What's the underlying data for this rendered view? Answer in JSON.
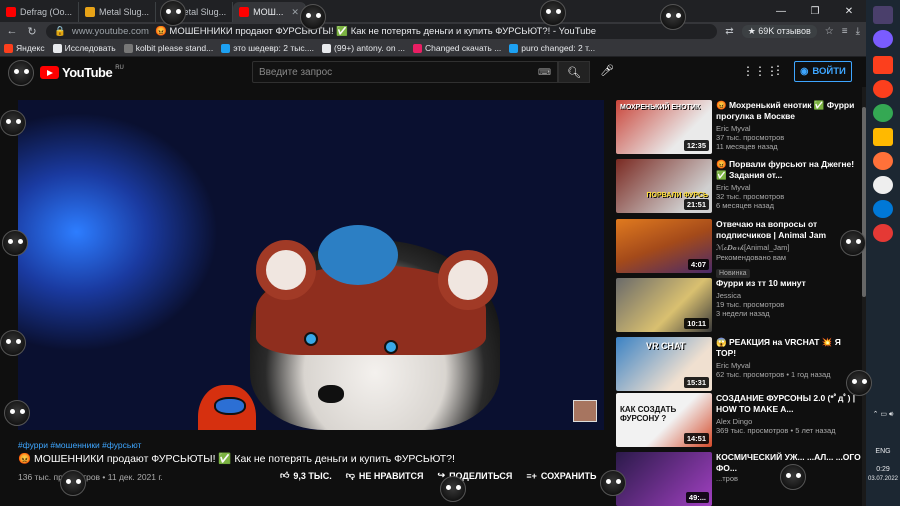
{
  "browser": {
    "tabs": [
      {
        "title": "Defrag (Oo...",
        "fav": "#ff0000",
        "active": false
      },
      {
        "title": "Metal Slug...",
        "fav": "#e8a317",
        "active": false
      },
      {
        "title": "Metal Slug...",
        "fav": "#e8a317",
        "active": false
      },
      {
        "title": "МОШ...",
        "fav": "#ff0000",
        "active": true
      }
    ],
    "window_controls": [
      "—",
      "❐",
      "✕"
    ],
    "address": {
      "url": "www.youtube.com",
      "page_title": "😡 МОШЕННИКИ продают ФУРСЬЮТЫ! ✅ Как не потерять деньги и купить ФУРСЬЮТ?! - YouTube",
      "rating": "★ 69K отзывов"
    },
    "bookmarks": [
      {
        "label": "Яндекс",
        "color": "#fc3f1d"
      },
      {
        "label": "Исследовать",
        "color": "#e8eaed"
      },
      {
        "label": "kolbit please stand...",
        "color": "#777"
      },
      {
        "label": "это шедевр: 2 тыс....",
        "color": "#1da1f2"
      },
      {
        "label": "(99+) antony. on ...",
        "color": "#e8eaed"
      },
      {
        "label": "Changed скачать ...",
        "color": "#e91e63"
      },
      {
        "label": "puro changed: 2 т...",
        "color": "#1da1f2"
      }
    ]
  },
  "youtube": {
    "logo_text": "YouTube",
    "logo_region": "RU",
    "search_placeholder": "Введите запрос",
    "signin_label": "ВОЙТИ",
    "video": {
      "hashtags": "#фурри #мошенники #фурсьют",
      "title": "😡 МОШЕННИКИ продают ФУРСЬЮТЫ! ✅ Как не потерять деньги и купить ФУРСЬЮТ?!",
      "meta": "136 тыс. просмотров • 11 дек. 2021 г.",
      "likes": "9,3 ТЫС.",
      "dislike_label": "НЕ НРАВИТСЯ",
      "share_label": "ПОДЕЛИТЬСЯ",
      "save_label": "СОХРАНИТЬ"
    },
    "related": [
      {
        "title": "😡 Мохренький енотик ✅ Фурри прогулка в Москве",
        "channel": "Eric Myval",
        "stats": "37 тыс. просмотров",
        "age": "11 месяцев назад",
        "duration": "12:35",
        "badge": "",
        "caption": "МОХРЕНЬКИЙ ЕНОТИК",
        "colors": [
          "#c9453a",
          "#eaeaea"
        ]
      },
      {
        "title": "😡 Порвали фурсьют на Джегне! ✅ Задания от...",
        "channel": "Eric Myval",
        "stats": "32 тыс. просмотров",
        "age": "6 месяцев назад",
        "duration": "21:51",
        "badge": "",
        "caption": "ПОРВАЛИ ФУРСЬ",
        "colors": [
          "#7a2a22",
          "#d0d0d0"
        ]
      },
      {
        "title": "Отвечаю на вопросы от подписчиков | Animal Jam",
        "channel": "ℳ𝒸𝑫𝒶𝓇𝓀[Animal_Jam]",
        "stats": "Рекомендовано вам",
        "age": "",
        "duration": "4:07",
        "badge": "Новинка",
        "caption": "",
        "colors": [
          "#e07a1f",
          "#4a2a6a"
        ]
      },
      {
        "title": "Фурри из тт 10 минут",
        "channel": "Jessica",
        "stats": "19 тыс. просмотров",
        "age": "3 недели назад",
        "duration": "10:11",
        "badge": "",
        "caption": "",
        "colors": [
          "#6a6a6a",
          "#d9c070"
        ]
      },
      {
        "title": "😱 РЕАКЦИЯ на VRCHAT 💥 Я ТОР!",
        "channel": "Eric Myval",
        "stats": "62 тыс. просмотров • 1 год назад",
        "age": "",
        "duration": "15:31",
        "badge": "",
        "caption": "VR CHAT",
        "colors": [
          "#3b82c4",
          "#f0e0d0"
        ]
      },
      {
        "title": "СОЗДАНИЕ ФУРСОНЫ 2.0 (*ﾟдﾟ) | HOW TO MAKE A...",
        "channel": "Alex Dingo",
        "stats": "369 тыс. просмотров • 5 лет назад",
        "age": "",
        "duration": "14:51",
        "badge": "",
        "caption": "КАК СОЗДАТЬ ФУРСОНУ ?",
        "colors": [
          "#f2f2f2",
          "#d44a2a"
        ]
      },
      {
        "title": "КОСМИЧЕСКИЙ УЖ... ...АЛ... ...ОГО ФО...",
        "channel": "",
        "stats": "...тров",
        "age": "",
        "duration": "49:...",
        "badge": "",
        "caption": "",
        "colors": [
          "#2b1a4a",
          "#a040c0"
        ]
      }
    ]
  },
  "taskbar": {
    "apps": [
      "#4a3f6b",
      "#7a5cff",
      "#fc3f1d",
      "#ffb900",
      "#34a853",
      "#ff7139",
      "#fc3f1d",
      "#0078d7",
      "#e53935"
    ],
    "tray": {
      "lang": "ENG",
      "time": "0:29",
      "date": "03.07.2022"
    }
  }
}
